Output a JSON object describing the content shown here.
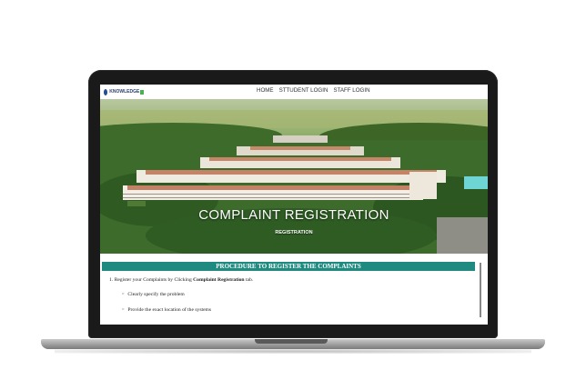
{
  "nav": {
    "logo_text": "KNOWLEDGE",
    "links": [
      "HOME",
      "STTUDENT LOGIN",
      "STAFF LOGIN"
    ]
  },
  "hero": {
    "title": "COMPLAINT REGISTRATION",
    "subtitle": "REGISTRATION"
  },
  "procedure": {
    "header": "PROCEDURE TO REGISTER THE COMPLAINTS",
    "step1_prefix": "1. Register your Complaints by Clicking ",
    "step1_bold": "Complaint Registration",
    "step1_suffix": " tab.",
    "bullets": [
      "Clearly specify the problem",
      "Provide the exact location of the systems"
    ]
  },
  "colors": {
    "accent": "#1f8a80",
    "laptop_bezel": "#1a1a1a"
  }
}
